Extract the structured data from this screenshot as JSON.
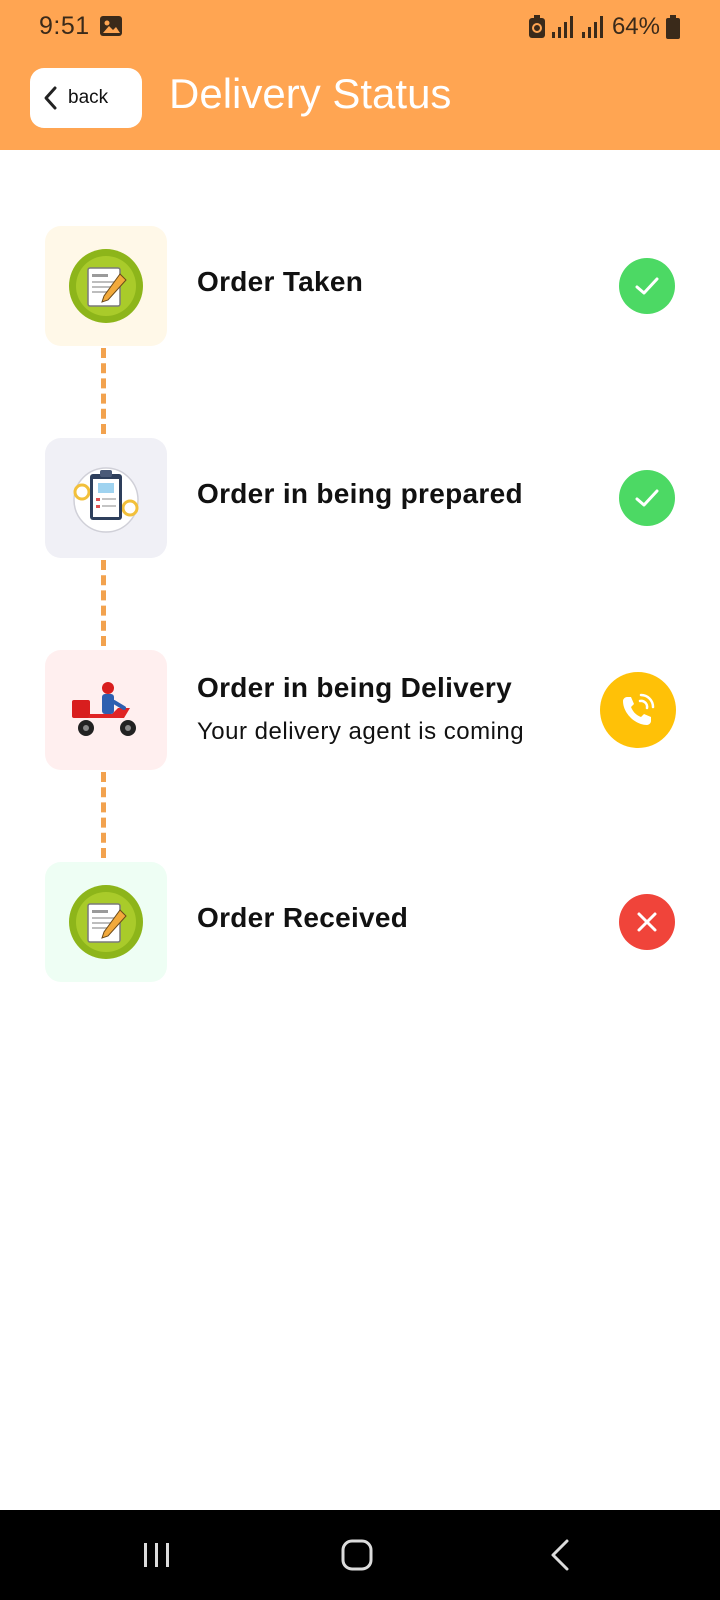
{
  "status_bar": {
    "time": "9:51",
    "battery": "64%",
    "icons": [
      "gallery-icon",
      "battery-saver-icon",
      "signal-icon",
      "signal-icon",
      "battery-icon"
    ]
  },
  "header": {
    "back_label": "back",
    "title": "Delivery Status",
    "background_color": "#FFA552"
  },
  "steps": [
    {
      "title": "Order Taken",
      "subtitle": "",
      "icon": "order-note-icon",
      "tile_color": "#FFF8E8",
      "status": "done",
      "status_icon": "check-icon",
      "status_color": "#4CD964"
    },
    {
      "title": "Order in being prepared",
      "subtitle": "",
      "icon": "clipboard-icon",
      "tile_color": "#F0F0F6",
      "status": "done",
      "status_icon": "check-icon",
      "status_color": "#4CD964"
    },
    {
      "title": "Order in being Delivery",
      "subtitle": "Your delivery agent is coming",
      "icon": "delivery-scooter-icon",
      "tile_color": "#FFEFEF",
      "status": "call",
      "status_icon": "phone-icon",
      "status_color": "#FFC107"
    },
    {
      "title": "Order Received",
      "subtitle": "",
      "icon": "order-note-icon",
      "tile_color": "#EEFEF4",
      "status": "pending",
      "status_icon": "close-icon",
      "status_color": "#F0443A"
    }
  ],
  "nav_bar": {
    "icons": [
      "recent-apps-icon",
      "home-icon",
      "back-arrow-icon"
    ]
  }
}
